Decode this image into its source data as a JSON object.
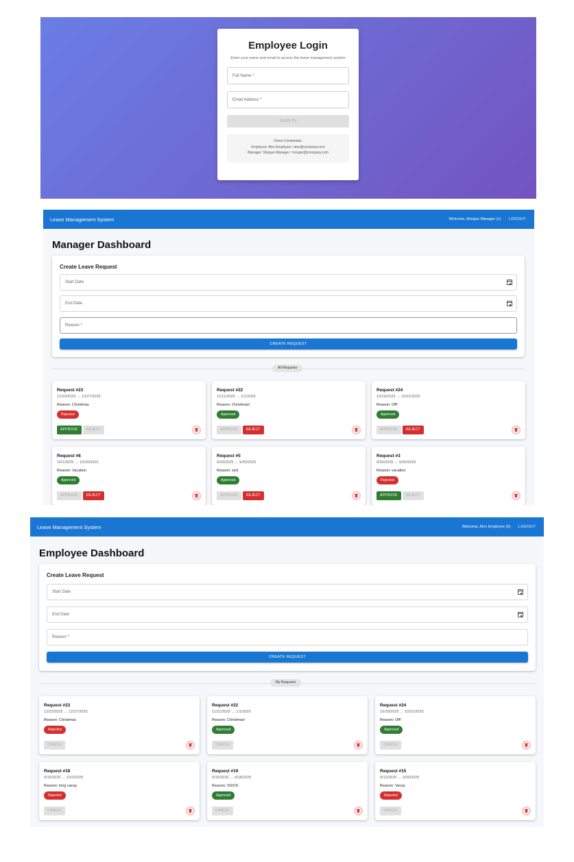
{
  "login": {
    "title": "Employee Login",
    "subtitle": "Enter your name and email to access the leave management system",
    "name_placeholder": "Full Name *",
    "email_placeholder": "Email Address *",
    "signin_label": "SIGN IN",
    "demo_heading": "Demo Credentials:",
    "demo_employee": "Employee: Alex Employee / alex@company.com",
    "demo_manager": "Manager: Morgan Manager / morgan@company.com"
  },
  "manager": {
    "app_title": "Leave Management System",
    "welcome": "Welcome, Morgan Manager (1)",
    "logout": "LOGOUT",
    "dashboard_title": "Manager Dashboard",
    "create": {
      "title": "Create Leave Request",
      "start_date": "Start Date",
      "end_date": "End Date",
      "reason": "Reason *",
      "button": "CREATE REQUEST"
    },
    "list_label": "All Requests",
    "requests": [
      {
        "title": "Request #23",
        "dates": "12/23/2025 → 12/27/2025",
        "reason": "Reason: Christmas",
        "status": "Rejected",
        "btn1": "APPROVE",
        "btn2": "REJECT"
      },
      {
        "title": "Request #22",
        "dates": "11/11/2025 → 1/1/2026",
        "reason": "Reason: Christmas!",
        "status": "Approved",
        "btn1": "APPROVE",
        "btn2": "REJECT"
      },
      {
        "title": "Request #24",
        "dates": "10/16/2025 → 10/21/2025",
        "reason": "Reason: Off!",
        "status": "Approved",
        "btn1": "APPROVE",
        "btn2": "REJECT"
      },
      {
        "title": "Request #8",
        "dates": "10/1/2025 → 10/30/2025",
        "reason": "Reason: Vacation",
        "status": "Approved",
        "btn1": "APPROVE",
        "btn2": "REJECT"
      },
      {
        "title": "Request #5",
        "dates": "9/29/2025 → 9/30/2025",
        "reason": "Reason: sick",
        "status": "Approved",
        "btn1": "APPROVE",
        "btn2": "REJECT"
      },
      {
        "title": "Request #3",
        "dates": "9/26/2025 → 9/30/2025",
        "reason": "Reason: vacation",
        "status": "Rejected",
        "btn1": "APPROVE",
        "btn2": "REJECT"
      }
    ]
  },
  "employee": {
    "app_title": "Leave Management System",
    "welcome": "Welcome, Alex Employee (0)",
    "logout": "LOGOUT",
    "dashboard_title": "Employee Dashboard",
    "create": {
      "title": "Create Leave Request",
      "start_date": "Start Date",
      "end_date": "End Date",
      "reason": "Reason *",
      "button": "CREATE REQUEST"
    },
    "list_label": "My Requests",
    "requests": [
      {
        "title": "Request #23",
        "dates": "12/23/2025 → 12/27/2025",
        "reason": "Reason: Christmas",
        "status": "Rejected",
        "btn1": "CANCEL"
      },
      {
        "title": "Request #22",
        "dates": "11/11/2025 → 1/1/2026",
        "reason": "Reason: Christmas!",
        "status": "Approved",
        "btn1": "CANCEL"
      },
      {
        "title": "Request #24",
        "dates": "10/16/2025 → 10/21/2025",
        "reason": "Reason: Off!",
        "status": "Approved",
        "btn1": "CANCEL"
      },
      {
        "title": "Request #18",
        "dates": "9/15/2025 → 10/3/2025",
        "reason": "Reason: long vacay",
        "status": "Rejected",
        "btn1": "CANCEL"
      },
      {
        "title": "Request #19",
        "dates": "9/15/2025 → 9/18/2025",
        "reason": "Reason: SSICK",
        "status": "Approved",
        "btn1": "CANCEL"
      },
      {
        "title": "Request #15",
        "dates": "9/12/2025 → 9/30/2025",
        "reason": "Reason: Vacay",
        "status": "Rejected",
        "btn1": "CANCEL"
      }
    ]
  },
  "colors": {
    "primary": "#1976d2",
    "approved": "#2e7d32",
    "rejected": "#d32f2f",
    "login_gradient_start": "#6a7ee6",
    "login_gradient_end": "#7354c0"
  }
}
